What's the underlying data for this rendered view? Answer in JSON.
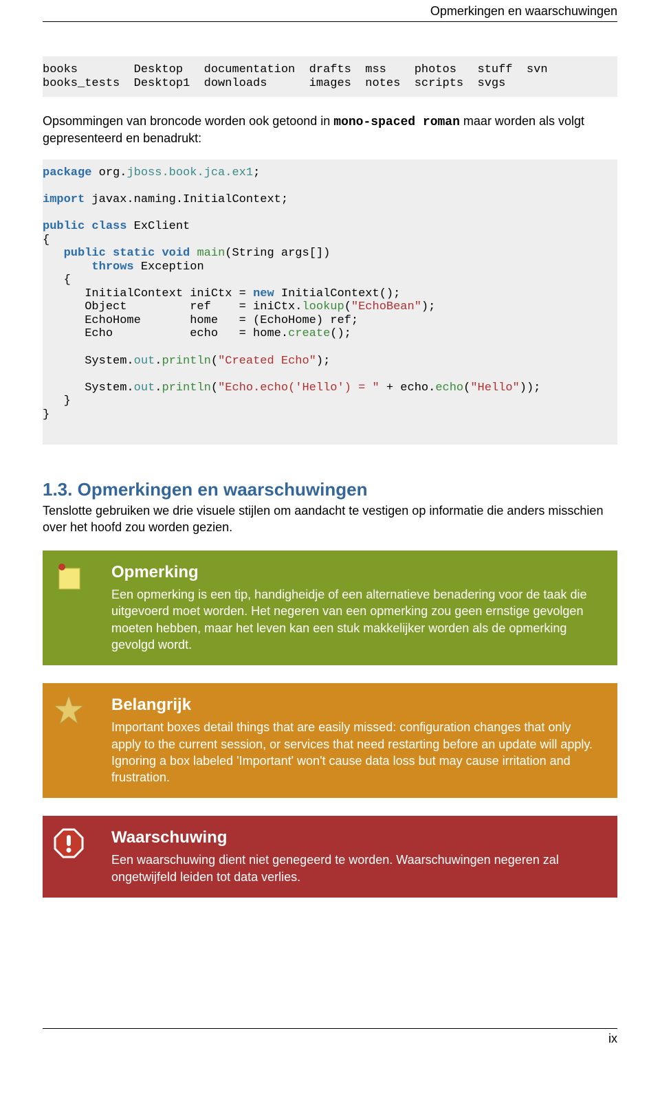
{
  "running_head": "Opmerkingen en waarschuwingen",
  "listing1": "books        Desktop   documentation  drafts  mss    photos   stuff  svn\nbooks_tests  Desktop1  downloads      images  notes  scripts  svgs",
  "intro": {
    "pre": "Opsommingen van broncode worden ook getoond in ",
    "mono": "mono-spaced roman",
    "post": " maar worden als volgt gepresenteerd en benadrukt:"
  },
  "java": {
    "l1_kw": "package",
    "l1_rest": " org.",
    "l1_pkg": "jboss.book.jca.ex1",
    "l1_semi": ";",
    "l3_kw": "import",
    "l3_rest": " javax.naming.InitialContext;",
    "l5_a": "public",
    "l5_b": "class",
    "l5_rest": " ExClient",
    "l6": "{",
    "l7_ind": "   ",
    "l7_a": "public",
    "l7_b": "static",
    "l7_c": "void",
    "l7_fn": "main",
    "l7_args": "(String args[])",
    "l8_ind": "       ",
    "l8_kw": "throws",
    "l8_rest": " Exception",
    "l9": "   {",
    "l10_a": "      InitialContext iniCtx = ",
    "l10_kw": "new",
    "l10_b": " InitialContext();",
    "l11_a": "      Object         ref    = iniCtx.",
    "l11_fn": "lookup",
    "l11_b": "(",
    "l11_lit": "\"EchoBean\"",
    "l11_c": ");",
    "l12": "      EchoHome       home   = (EchoHome) ref;",
    "l13_a": "      Echo           echo   = home.",
    "l13_fn": "create",
    "l13_b": "();",
    "l15_a": "      System.",
    "l15_out": "out",
    "l15_b": ".",
    "l15_fn": "println",
    "l15_c": "(",
    "l15_lit": "\"Created Echo\"",
    "l15_d": ");",
    "l17_a": "      System.",
    "l17_out": "out",
    "l17_b": ".",
    "l17_fn": "println",
    "l17_c": "(",
    "l17_lit": "\"Echo.echo('Hello') = \"",
    "l17_d": " + echo.",
    "l17_fn2": "echo",
    "l17_e": "(",
    "l17_lit2": "\"Hello\"",
    "l17_f": "));",
    "l18": "   }",
    "l19": "}"
  },
  "section": {
    "heading": "1.3. Opmerkingen en waarschuwingen",
    "text": "Tenslotte gebruiken we drie visuele stijlen om aandacht te vestigen op informatie die anders misschien over het hoofd zou worden gezien."
  },
  "note": {
    "title": "Opmerking",
    "body": "Een opmerking is een tip, handigheidje of een alternatieve benadering voor de taak die uitgevoerd moet worden. Het negeren van een opmerking zou geen ernstige gevolgen moeten hebben, maar het leven kan een stuk makkelijker worden als de opmerking gevolgd wordt."
  },
  "important": {
    "title": "Belangrijk",
    "body": "Important boxes detail things that are easily missed: configuration changes that only apply to the current session, or services that need restarting before an update will apply. Ignoring a box labeled 'Important' won't cause data loss but may cause irritation and frustration."
  },
  "warning": {
    "title": "Waarschuwing",
    "body": "Een waarschuwing dient niet genegeerd te worden. Waarschuwingen negeren zal ongetwijfeld leiden tot data verlies."
  },
  "page_number": "ix"
}
